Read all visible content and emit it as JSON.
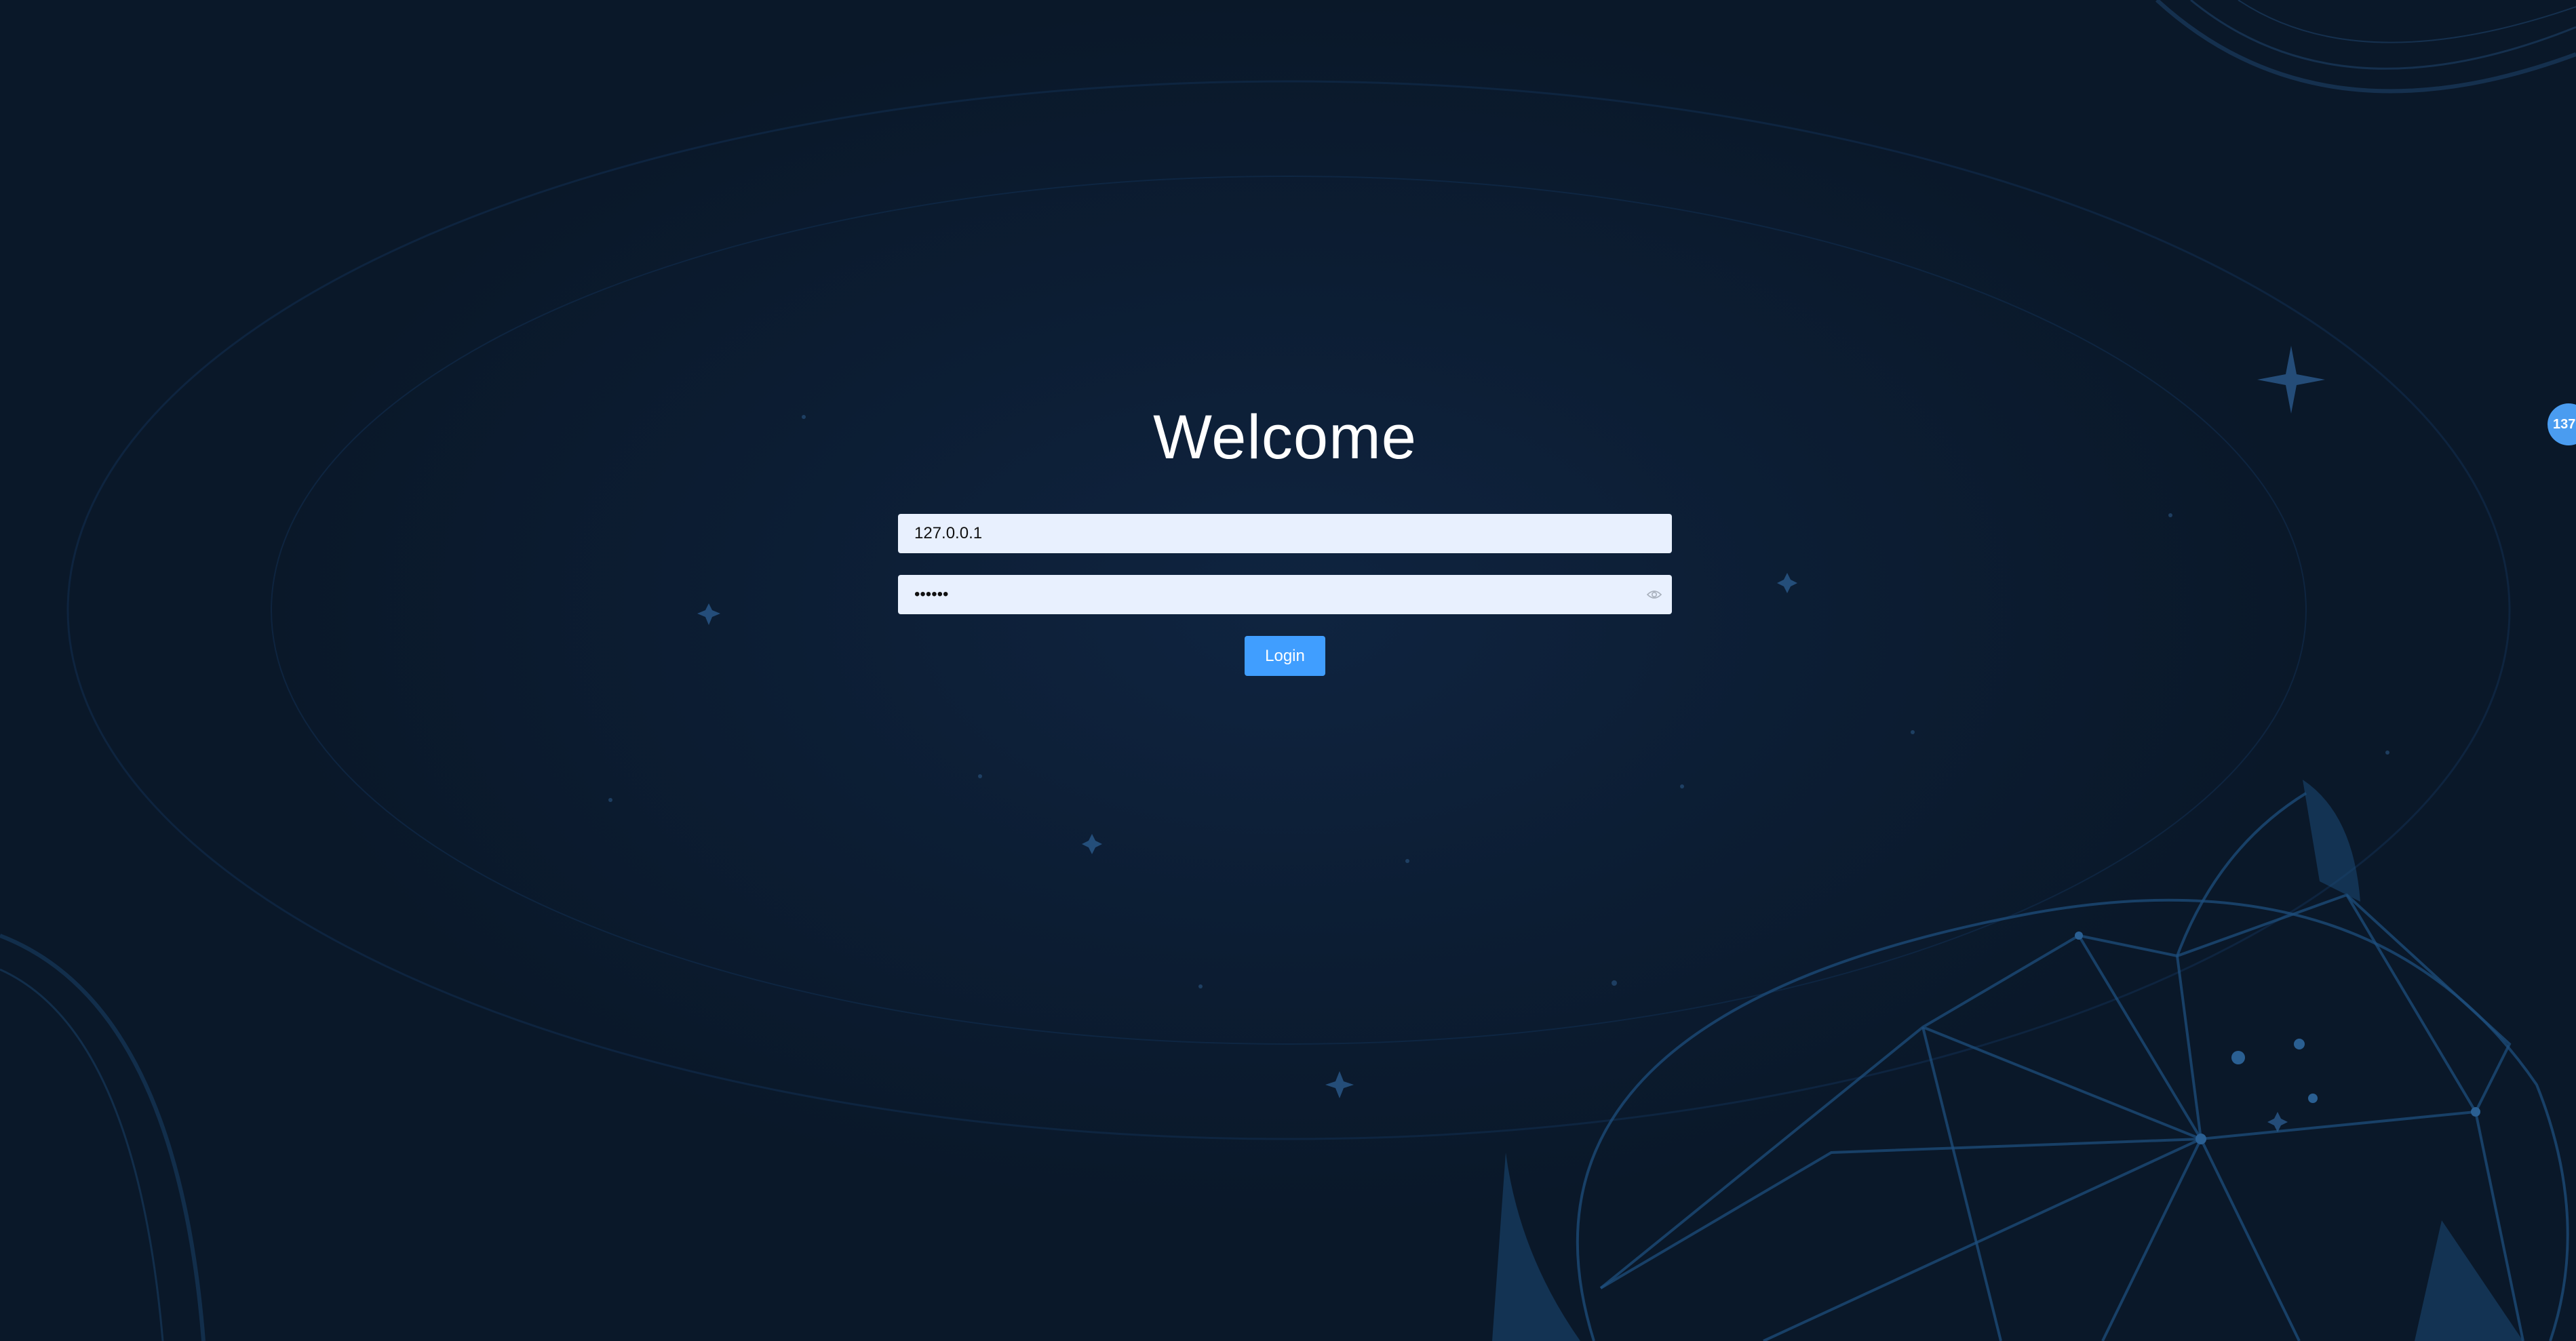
{
  "login": {
    "title": "Welcome",
    "host_value": "127.0.0.1",
    "password_value": "••••••",
    "password_toggle_icon": "eye-icon",
    "submit_label": "Login"
  },
  "side_badge": {
    "label": "137"
  },
  "colors": {
    "background": "#0d1b2e",
    "input_bg": "#e8f0fe",
    "button": "#409eff",
    "badge": "#4a9cf0"
  }
}
